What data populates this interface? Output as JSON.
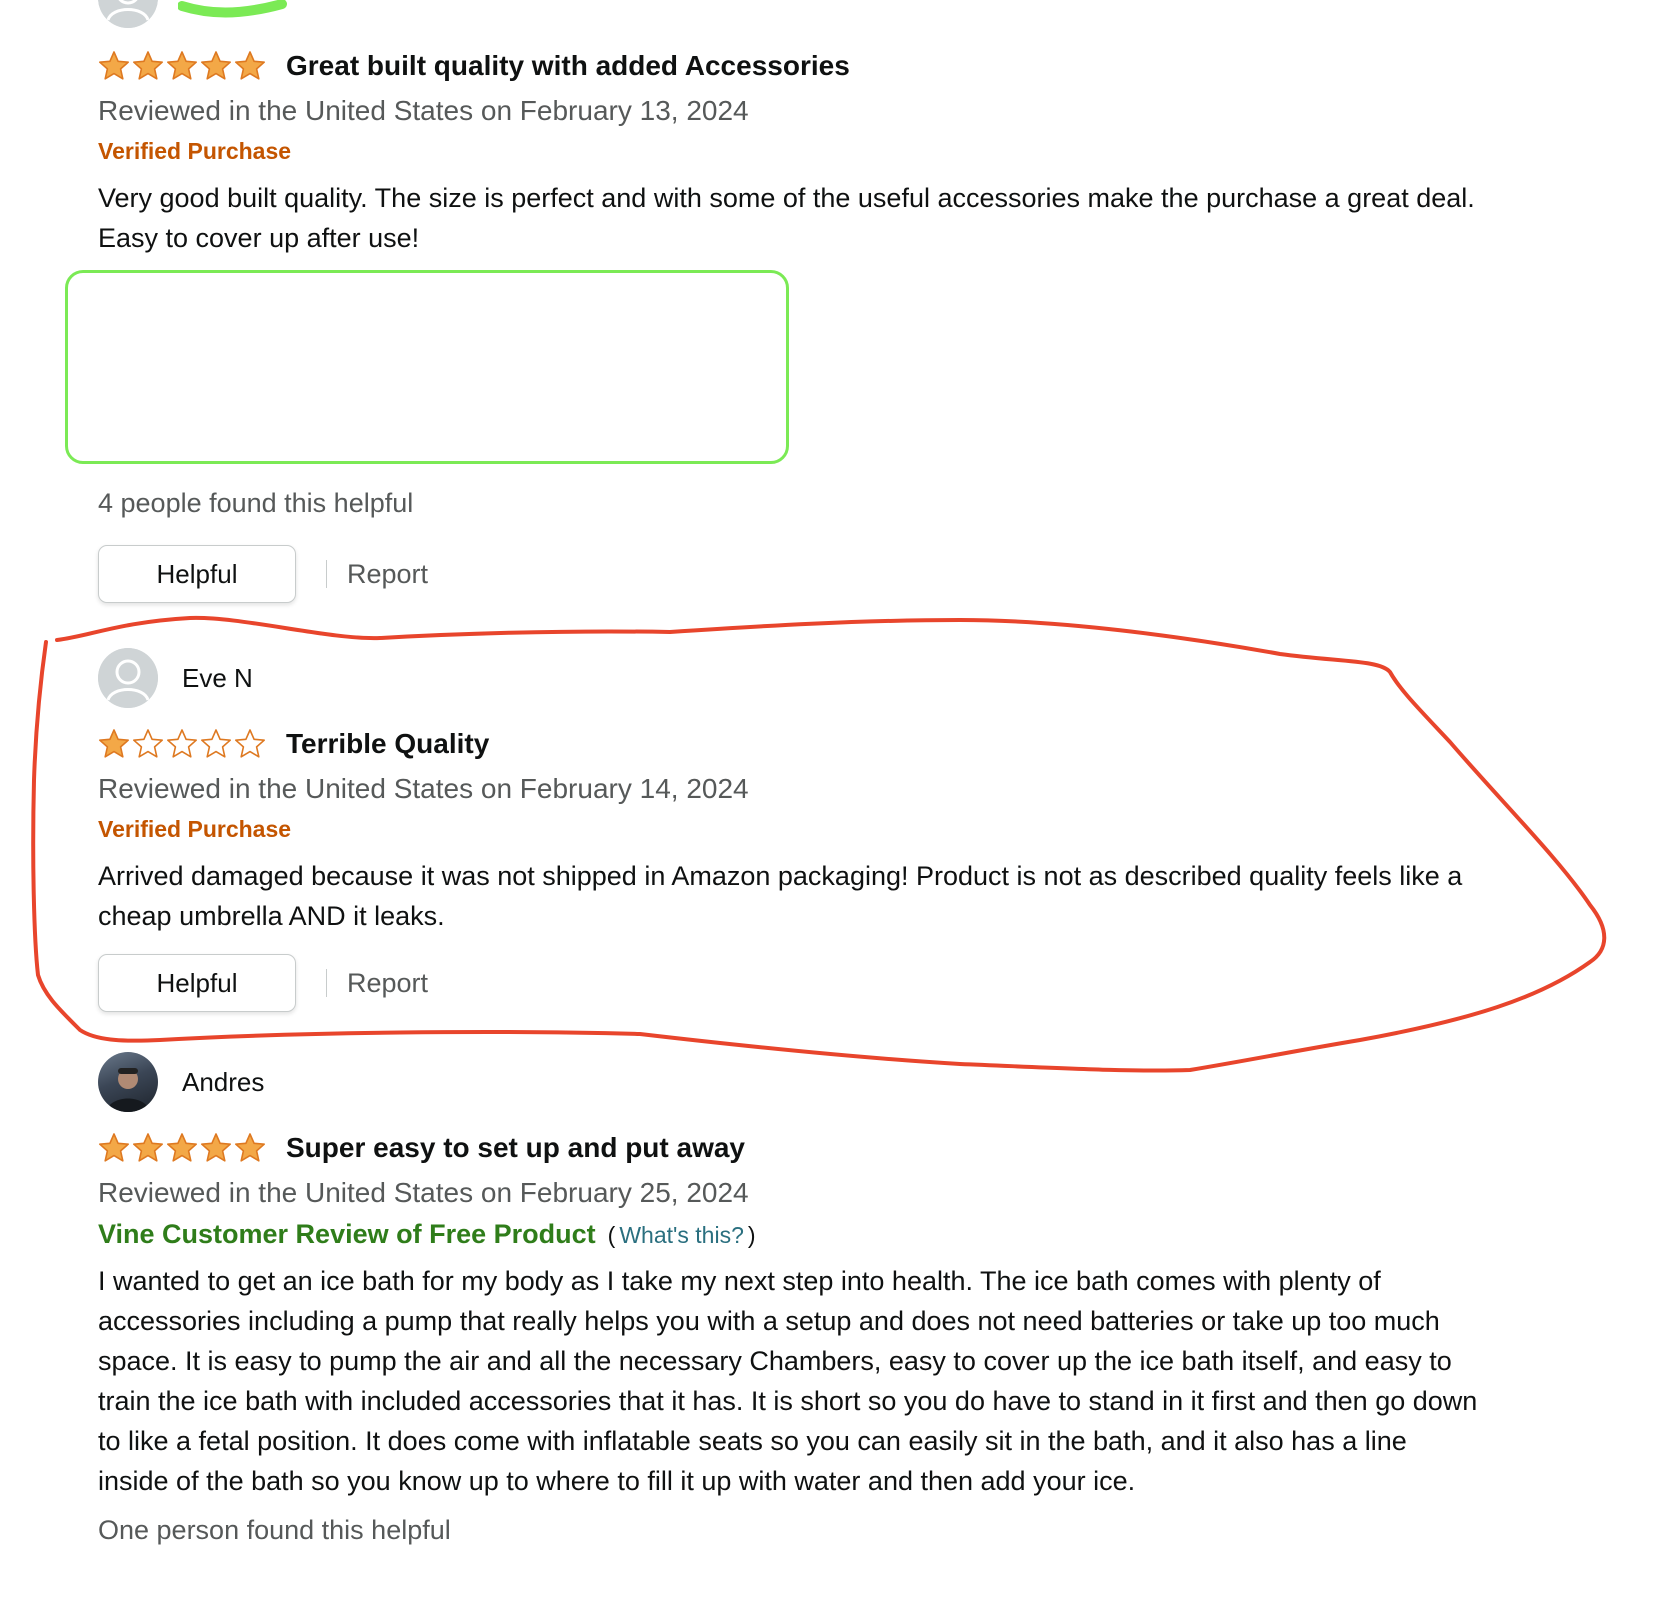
{
  "reviews": [
    {
      "rating": 5,
      "title": "Great built quality with added Accessories",
      "date": "Reviewed in the United States on February 13, 2024",
      "badge": "Verified Purchase",
      "body": "Very good built quality. The size is perfect and with some of the useful accessories make the purchase a great deal. Easy to cover up after use!",
      "helpful_count": "4 people found this helpful",
      "helpful_label": "Helpful",
      "report_label": "Report"
    },
    {
      "reviewer": "Eve N",
      "rating": 1,
      "title": "Terrible Quality",
      "date": "Reviewed in the United States on February 14, 2024",
      "badge": "Verified Purchase",
      "body": "Arrived damaged because it was not shipped in Amazon packaging! Product is not as described quality feels like a cheap umbrella AND it leaks.",
      "helpful_label": "Helpful",
      "report_label": "Report"
    },
    {
      "reviewer": "Andres",
      "rating": 5,
      "title": "Super easy to set up and put away",
      "date": "Reviewed in the United States on February 25, 2024",
      "vine_badge": "Vine Customer Review of Free Product",
      "vine_open": "(",
      "vine_link": "What's this?",
      "vine_close": ")",
      "body": "I wanted to get an ice bath for my body as I take my next step into health. The ice bath comes with plenty of accessories including a pump that really helps you with a setup and does not need batteries or take up too much space. It is easy to pump the air and all the necessary Chambers, easy to cover up the ice bath itself, and easy to train the ice bath with included accessories that it has. It is short so you do have to stand in it first and then go down to like a fetal position. It does come with inflatable seats so you can easily sit in the bath, and it also has a line inside of the bath so you know up to where to fill it up with water and then add your ice.",
      "helpful_count": "One person found this helpful"
    }
  ],
  "colors": {
    "star_fill": "#f3a847",
    "star_stroke": "#de7921",
    "verified": "#c45500",
    "vine": "#2f7d1a",
    "link": "#2a6f7f",
    "annotation_red": "#e8452c",
    "annotation_green": "#7bea55"
  },
  "icons": {
    "avatar": "default-person-avatar-icon",
    "star_full": "star-filled-icon",
    "star_empty": "star-empty-icon"
  }
}
